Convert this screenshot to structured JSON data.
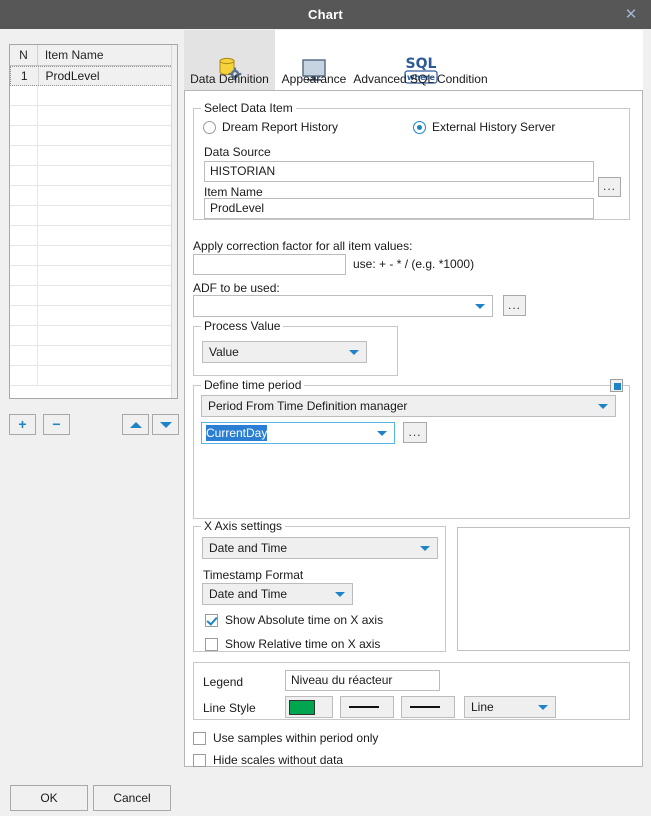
{
  "window": {
    "title": "Chart",
    "close_icon": "close-icon"
  },
  "item_list": {
    "columns": [
      "N",
      "Item Name"
    ],
    "rows": [
      {
        "n": "1",
        "name": "ProdLevel"
      }
    ],
    "buttons": {
      "add": "+",
      "remove": "−",
      "move_up": "move-up",
      "move_down": "move-down"
    }
  },
  "tabs": [
    {
      "label": "Data Definition",
      "icon": "database-gear-icon",
      "active": true
    },
    {
      "label": "Appearance",
      "icon": "monitor-icon",
      "active": false
    },
    {
      "label": "Advanced SQL Condition",
      "icon": "sql-where-icon",
      "active": false
    }
  ],
  "select_data_item": {
    "caption": "Select Data Item",
    "radio_dream": "Dream Report History",
    "radio_external": "External History Server",
    "selected": "External History Server",
    "data_source_label": "Data Source",
    "data_source_value": "HISTORIAN",
    "item_name_label": "Item Name",
    "item_name_value": "ProdLevel",
    "browse_button": "..."
  },
  "correction": {
    "label": "Apply correction factor for all item values:",
    "value": "",
    "hint": "use: + - * /  (e.g. *1000)"
  },
  "adf": {
    "label": "ADF to be used:",
    "value": "",
    "browse_button": "..."
  },
  "process_value": {
    "caption": "Process Value",
    "value": "Value"
  },
  "time_period": {
    "caption": "Define time period",
    "mode": "Period From Time Definition manager",
    "period_value": "CurrentDay",
    "browse_button": "...",
    "expand_button": "expand-toggle"
  },
  "x_axis": {
    "caption": "X Axis settings",
    "axis_type": "Date and Time",
    "timestamp_format_label": "Timestamp Format",
    "timestamp_format": "Date and Time",
    "show_absolute_label": "Show Absolute time on X axis",
    "show_absolute_checked": true,
    "show_relative_label": "Show Relative time on X axis",
    "show_relative_checked": false
  },
  "legend_panel": {
    "legend_label": "Legend",
    "legend_value": "Niveau du réacteur",
    "line_style_label": "Line Style",
    "line_color": "#00a550",
    "line_width": "thick",
    "line_pattern": "solid",
    "chart_type": "Line"
  },
  "options": {
    "use_samples_label": "Use samples within period only",
    "use_samples_checked": false,
    "hide_scales_label": "Hide scales without data",
    "hide_scales_checked": false
  },
  "footer": {
    "ok": "OK",
    "cancel": "Cancel"
  },
  "colors": {
    "titlebar": "#575757",
    "accent": "#1d84c8",
    "selection": "#2a7fd4",
    "line_green": "#00a550"
  }
}
